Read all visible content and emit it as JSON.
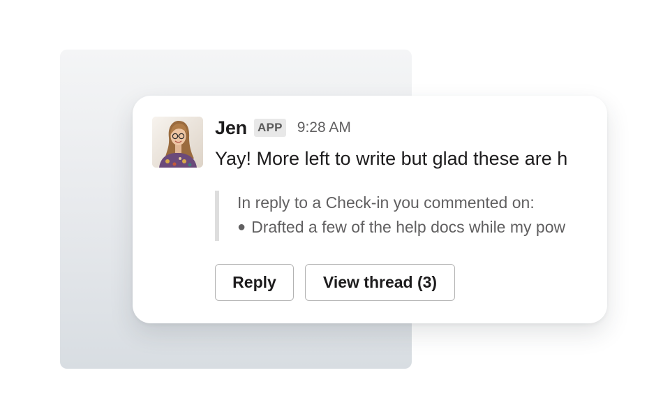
{
  "message": {
    "sender": "Jen",
    "badge": "APP",
    "timestamp": "9:28 AM",
    "text": "Yay! More left to write but glad these are h",
    "avatar_icon": "user-photo-avatar"
  },
  "quote": {
    "intro": "In reply to a Check-in you commented on:",
    "bullet_text": "Drafted a few of the help docs while my pow"
  },
  "actions": {
    "reply_label": "Reply",
    "view_thread_label": "View thread (3)"
  },
  "colors": {
    "text_primary": "#1d1c1d",
    "text_secondary": "#616061",
    "quote_bar": "#dddddd",
    "button_border": "#b3b3b3",
    "badge_bg": "#e8e8e8"
  }
}
